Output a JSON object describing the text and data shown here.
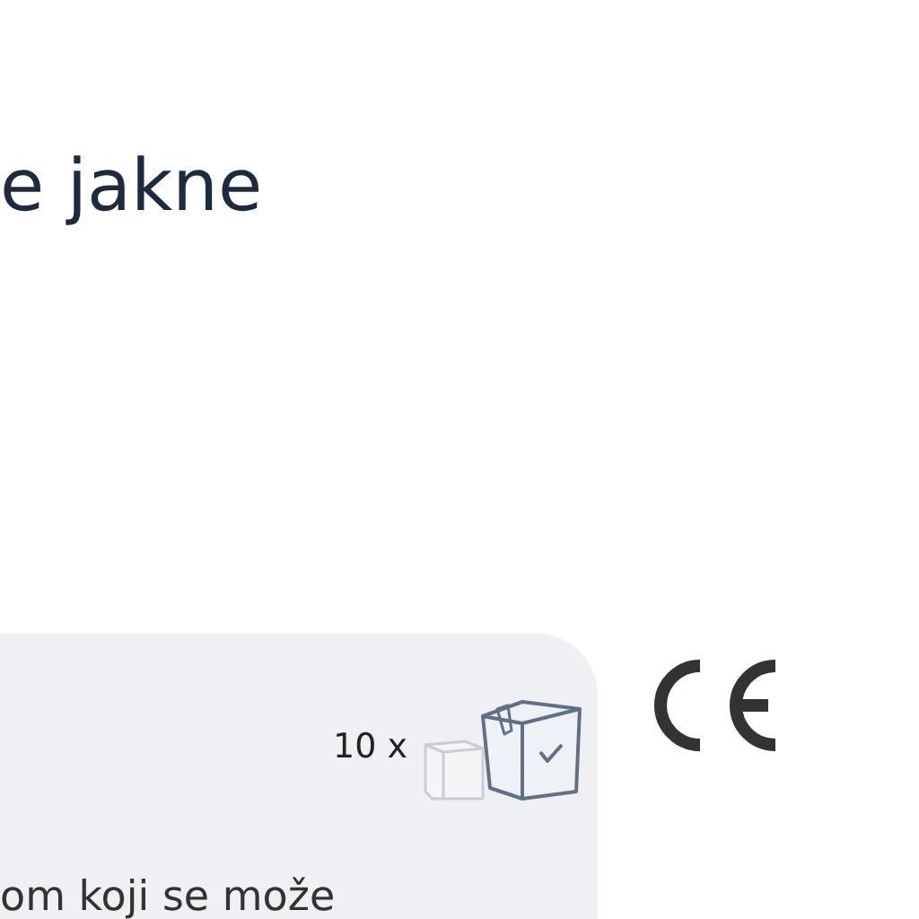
{
  "heading": "e jakne",
  "card": {
    "quantity": "10 x",
    "text": "om koji se može"
  }
}
